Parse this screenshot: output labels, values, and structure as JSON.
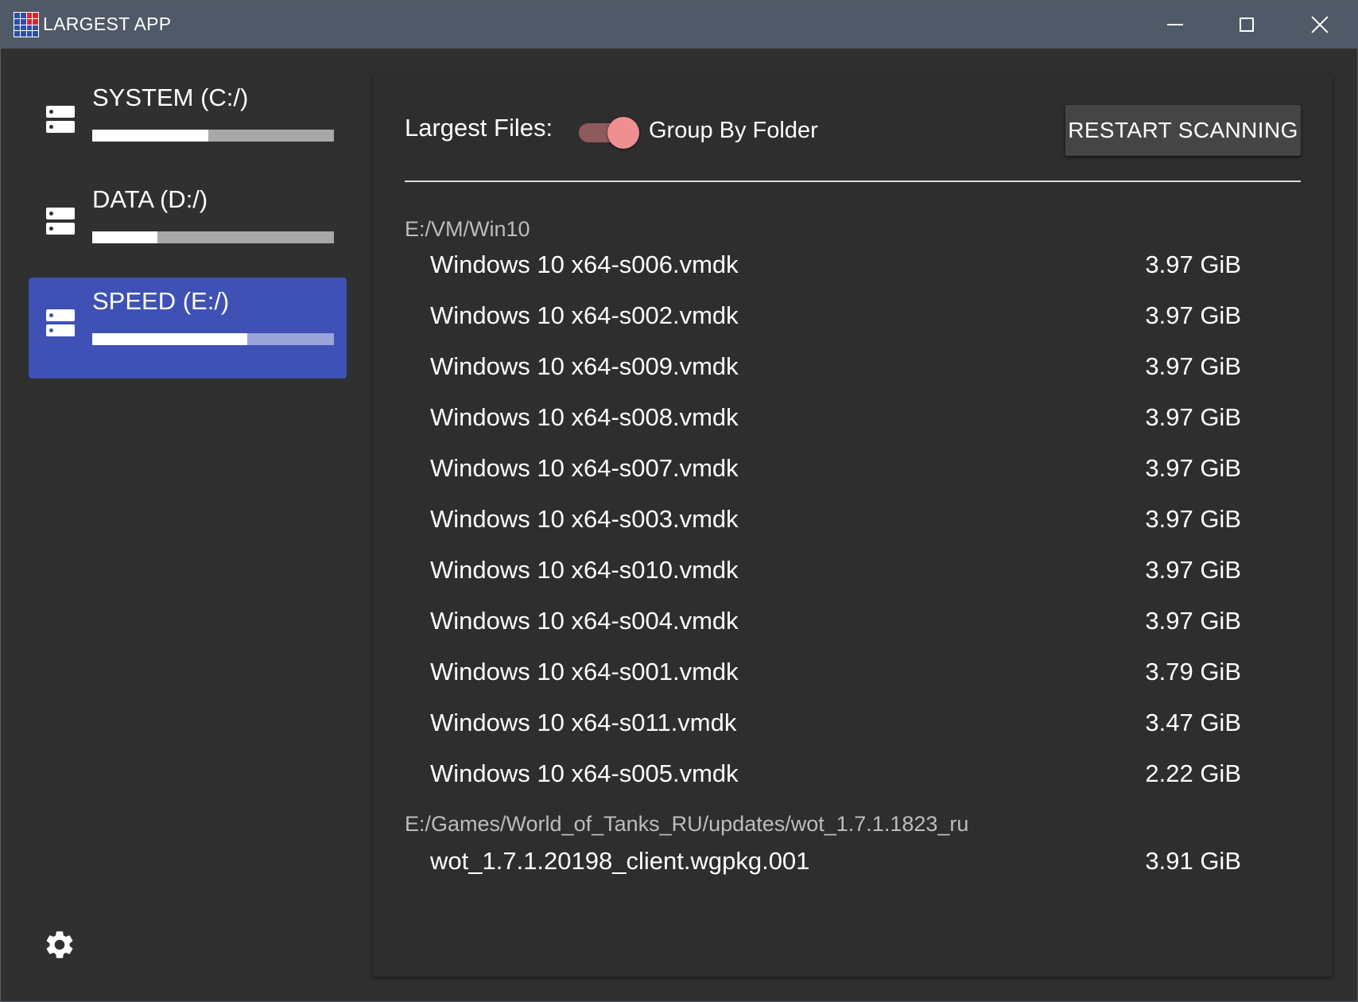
{
  "window": {
    "title": "LARGEST APP"
  },
  "sidebar": {
    "drives": [
      {
        "label": "SYSTEM (C:/)",
        "used_fraction": 0.48,
        "selected": false
      },
      {
        "label": "DATA (D:/)",
        "used_fraction": 0.27,
        "selected": false
      },
      {
        "label": "SPEED (E:/)",
        "used_fraction": 0.64,
        "selected": true
      }
    ]
  },
  "main": {
    "title": "Largest Files:",
    "toggle_label": "Group By Folder",
    "toggle_on": true,
    "restart_label": "RESTART SCANNING",
    "groups": [
      {
        "path": "E:/VM/Win10",
        "files": [
          {
            "name": "Windows 10 x64-s006.vmdk",
            "size": "3.97 GiB"
          },
          {
            "name": "Windows 10 x64-s002.vmdk",
            "size": "3.97 GiB"
          },
          {
            "name": "Windows 10 x64-s009.vmdk",
            "size": "3.97 GiB"
          },
          {
            "name": "Windows 10 x64-s008.vmdk",
            "size": "3.97 GiB"
          },
          {
            "name": "Windows 10 x64-s007.vmdk",
            "size": "3.97 GiB"
          },
          {
            "name": "Windows 10 x64-s003.vmdk",
            "size": "3.97 GiB"
          },
          {
            "name": "Windows 10 x64-s010.vmdk",
            "size": "3.97 GiB"
          },
          {
            "name": "Windows 10 x64-s004.vmdk",
            "size": "3.97 GiB"
          },
          {
            "name": "Windows 10 x64-s001.vmdk",
            "size": "3.79 GiB"
          },
          {
            "name": "Windows 10 x64-s011.vmdk",
            "size": "3.47 GiB"
          },
          {
            "name": "Windows 10 x64-s005.vmdk",
            "size": "2.22 GiB"
          }
        ]
      },
      {
        "path": "E:/Games/World_of_Tanks_RU/updates/wot_1.7.1.1823_ru",
        "files": [
          {
            "name": "wot_1.7.1.20198_client.wgpkg.001",
            "size": "3.91 GiB"
          }
        ]
      }
    ]
  },
  "icons": {
    "drive": "storage-icon",
    "settings": "gear-icon",
    "app": "grid-app-icon"
  },
  "colors": {
    "titlebar": "#4f5967",
    "background": "#303030",
    "selected_drive": "#3f51b5",
    "toggle_thumb": "#ef8f91"
  }
}
